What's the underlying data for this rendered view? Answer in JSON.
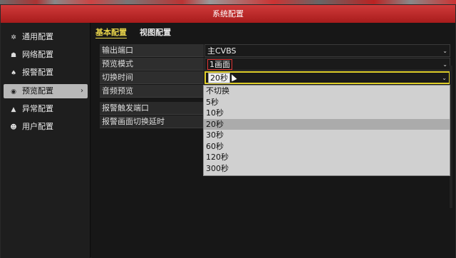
{
  "window": {
    "title": "系统配置"
  },
  "sidebar": {
    "items": [
      {
        "label": "通用配置",
        "icon": "gear-icon",
        "glyph": "✲",
        "active": false
      },
      {
        "label": "网络配置",
        "icon": "network-icon",
        "glyph": "☗",
        "active": false
      },
      {
        "label": "报警配置",
        "icon": "alarm-icon",
        "glyph": "♠",
        "active": false
      },
      {
        "label": "预览配置",
        "icon": "eye-icon",
        "glyph": "◉",
        "active": true,
        "arrow": "›"
      },
      {
        "label": "异常配置",
        "icon": "warning-icon",
        "glyph": "▲",
        "active": false
      },
      {
        "label": "用户配置",
        "icon": "users-icon",
        "glyph": "☻",
        "active": false
      }
    ]
  },
  "tabs": [
    {
      "label": "基本配置",
      "active": true
    },
    {
      "label": "视图配置",
      "active": false
    }
  ],
  "form": {
    "output_port": {
      "label": "输出端口",
      "value": "主CVBS"
    },
    "preview_mode": {
      "label": "预览模式",
      "value": "1画面"
    },
    "switch_time": {
      "label": "切换时间",
      "value": "20秒"
    },
    "audio_preview": {
      "label": "音频预览"
    },
    "alarm_trigger_port": {
      "label": "报警触发端口"
    },
    "alarm_switch_delay": {
      "label": "报警画面切换延时"
    }
  },
  "dropdown": {
    "options": [
      "不切换",
      "5秒",
      "10秒",
      "20秒",
      "30秒",
      "60秒",
      "120秒",
      "300秒"
    ],
    "highlighted": "20秒"
  },
  "colors": {
    "titlebar": "#c0282a",
    "tab_active": "#e6d14a",
    "focus_border": "#e0cf2a"
  }
}
